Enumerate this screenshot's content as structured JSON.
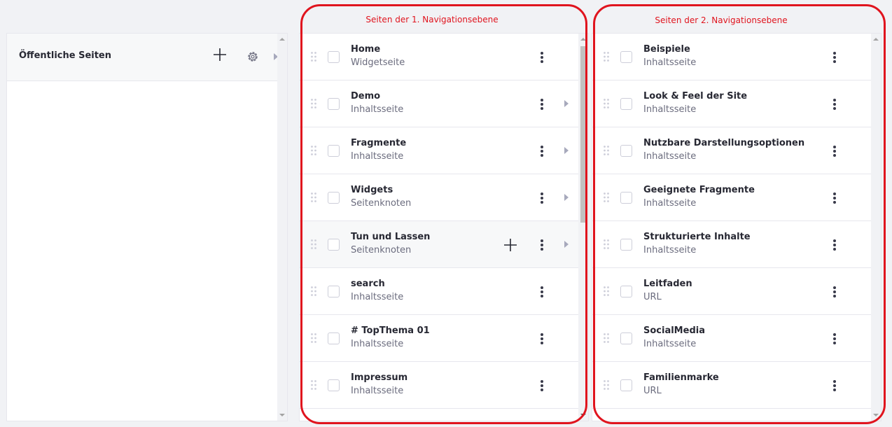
{
  "root": {
    "title": "Öffentliche Seiten"
  },
  "annotations": {
    "level1": "Seiten der 1. Navigationsebene",
    "level2": "Seiten der 2. Navigationsebene"
  },
  "level1": {
    "items": [
      {
        "title": "Home",
        "subtitle": "Widgetseite",
        "has_children": false
      },
      {
        "title": "Demo",
        "subtitle": "Inhaltsseite",
        "has_children": true
      },
      {
        "title": "Fragmente",
        "subtitle": "Inhaltsseite",
        "has_children": true
      },
      {
        "title": "Widgets",
        "subtitle": "Seitenknoten",
        "has_children": true
      },
      {
        "title": "Tun und Lassen",
        "subtitle": "Seitenknoten",
        "has_children": true
      },
      {
        "title": "search",
        "subtitle": "Inhaltsseite",
        "has_children": false
      },
      {
        "title": "# TopThema 01",
        "subtitle": "Inhaltsseite",
        "has_children": false
      },
      {
        "title": "Impressum",
        "subtitle": "Inhaltsseite",
        "has_children": false
      }
    ]
  },
  "level2": {
    "items": [
      {
        "title": "Beispiele",
        "subtitle": "Inhaltsseite"
      },
      {
        "title": "Look & Feel der Site",
        "subtitle": "Inhaltsseite"
      },
      {
        "title": "Nutzbare Darstellungsoptionen",
        "subtitle": "Inhaltsseite"
      },
      {
        "title": "Geeignete Fragmente",
        "subtitle": "Inhaltsseite"
      },
      {
        "title": "Strukturierte Inhalte",
        "subtitle": "Inhaltsseite"
      },
      {
        "title": "Leitfaden",
        "subtitle": "URL"
      },
      {
        "title": "SocialMedia",
        "subtitle": "Inhaltsseite"
      },
      {
        "title": "Familienmarke",
        "subtitle": "URL"
      }
    ]
  },
  "colors": {
    "annotation": "#e0141e",
    "border": "#e7e7ed",
    "muted": "#6b6c7e"
  },
  "icons": [
    "plus-icon",
    "gear-icon",
    "caret-right-icon",
    "drag-handle-icon",
    "kebab-icon"
  ]
}
